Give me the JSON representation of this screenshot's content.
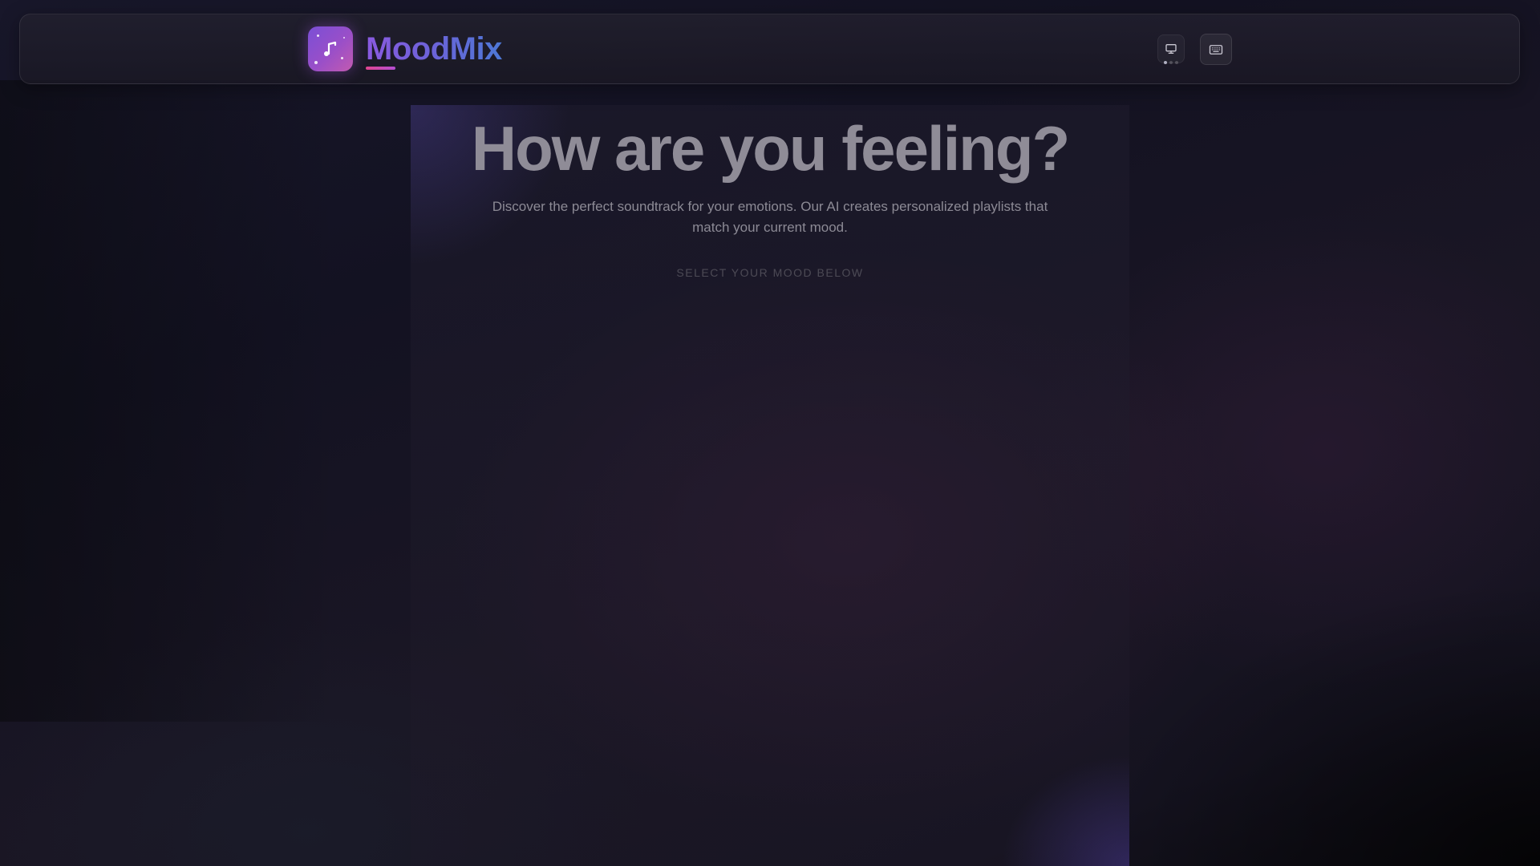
{
  "app": {
    "name": "MoodMix",
    "brand_colors": {
      "logo_start": "#7a4fd6",
      "logo_end": "#c25ab0",
      "wordmark_start": "#8a5ae0",
      "wordmark_end": "#4d78d6",
      "underline": "#e0458f"
    },
    "logo_icon": "music-note-icon"
  },
  "header": {
    "buttons": [
      {
        "id": "display",
        "icon": "monitor-icon"
      },
      {
        "id": "keyboard",
        "icon": "keyboard-icon"
      }
    ],
    "indicator": {
      "count": 3,
      "active_index": 0
    }
  },
  "hero": {
    "title": "How are you feeling?",
    "subtitle": "Discover the perfect soundtrack for your emotions. Our AI creates personalized playlists that match your current mood.",
    "prompt": "SELECT YOUR MOOD BELOW"
  }
}
